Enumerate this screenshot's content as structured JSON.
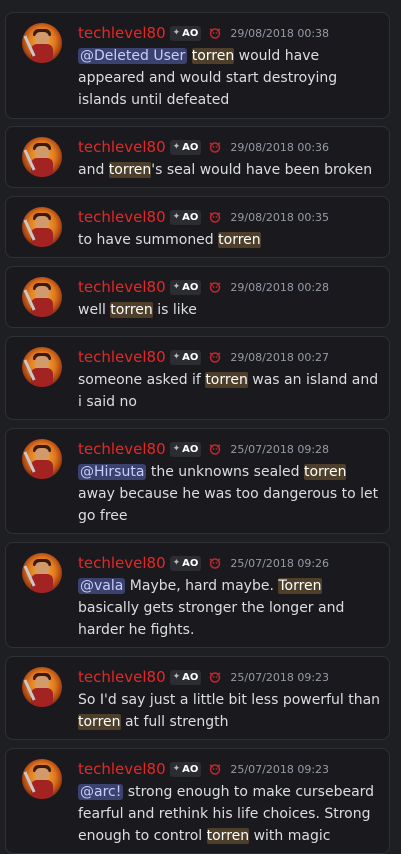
{
  "messages": [
    {
      "username": "techlevel80",
      "tag": "AO",
      "timestamp": "29/08/2018 00:38",
      "lines": [
        [
          {
            "t": "@Deleted User",
            "k": "mention"
          },
          {
            "t": " "
          },
          {
            "t": "torren",
            "k": "hl"
          },
          {
            "t": " would have"
          }
        ],
        [
          {
            "t": "appeared and would start destroying"
          }
        ],
        [
          {
            "t": "islands until defeated"
          }
        ]
      ]
    },
    {
      "username": "techlevel80",
      "tag": "AO",
      "timestamp": "29/08/2018 00:36",
      "lines": [
        [
          {
            "t": "and "
          },
          {
            "t": "torren",
            "k": "hl"
          },
          {
            "t": "'s seal would have been broken"
          }
        ]
      ]
    },
    {
      "username": "techlevel80",
      "tag": "AO",
      "timestamp": "29/08/2018 00:35",
      "lines": [
        [
          {
            "t": "to have summoned "
          },
          {
            "t": "torren",
            "k": "hl"
          }
        ]
      ]
    },
    {
      "username": "techlevel80",
      "tag": "AO",
      "timestamp": "29/08/2018 00:28",
      "lines": [
        [
          {
            "t": "well "
          },
          {
            "t": "torren",
            "k": "hl"
          },
          {
            "t": " is like"
          }
        ]
      ]
    },
    {
      "username": "techlevel80",
      "tag": "AO",
      "timestamp": "29/08/2018 00:27",
      "lines": [
        [
          {
            "t": "someone asked if "
          },
          {
            "t": "torren",
            "k": "hl"
          },
          {
            "t": " was an island and"
          }
        ],
        [
          {
            "t": "i said no"
          }
        ]
      ]
    },
    {
      "username": "techlevel80",
      "tag": "AO",
      "timestamp": "25/07/2018 09:28",
      "lines": [
        [
          {
            "t": "@Hirsuta",
            "k": "mention"
          },
          {
            "t": " the unknowns sealed "
          },
          {
            "t": "torren",
            "k": "hl"
          }
        ],
        [
          {
            "t": "away because he was too dangerous to let"
          }
        ],
        [
          {
            "t": "go free"
          }
        ]
      ]
    },
    {
      "username": "techlevel80",
      "tag": "AO",
      "timestamp": "25/07/2018 09:26",
      "lines": [
        [
          {
            "t": "@vala",
            "k": "mention"
          },
          {
            "t": " Maybe, hard maybe. "
          },
          {
            "t": "Torren",
            "k": "hl"
          }
        ],
        [
          {
            "t": "basically gets stronger the longer and"
          }
        ],
        [
          {
            "t": "harder he fights."
          }
        ]
      ]
    },
    {
      "username": "techlevel80",
      "tag": "AO",
      "timestamp": "25/07/2018 09:23",
      "lines": [
        [
          {
            "t": "So I'd say just a little bit less powerful than"
          }
        ],
        [
          {
            "t": "torren",
            "k": "hl"
          },
          {
            "t": " at full strength"
          }
        ]
      ]
    },
    {
      "username": "techlevel80",
      "tag": "AO",
      "timestamp": "25/07/2018 09:23",
      "lines": [
        [
          {
            "t": "@arc!",
            "k": "mention"
          },
          {
            "t": " strong enough to make cursebeard"
          }
        ],
        [
          {
            "t": "fearful and rethink his life choices. Strong"
          }
        ],
        [
          {
            "t": "enough to control "
          },
          {
            "t": "torren",
            "k": "hl"
          },
          {
            "t": " with magic"
          }
        ]
      ]
    }
  ],
  "colors": {
    "username": "#e62727",
    "mention_bg": "#3c4270",
    "highlight_bg": "#4e3f2a"
  },
  "icons": {
    "tag": "diamond-icon",
    "role": "demon-emblem-icon",
    "avatar": "warrior-avatar"
  }
}
